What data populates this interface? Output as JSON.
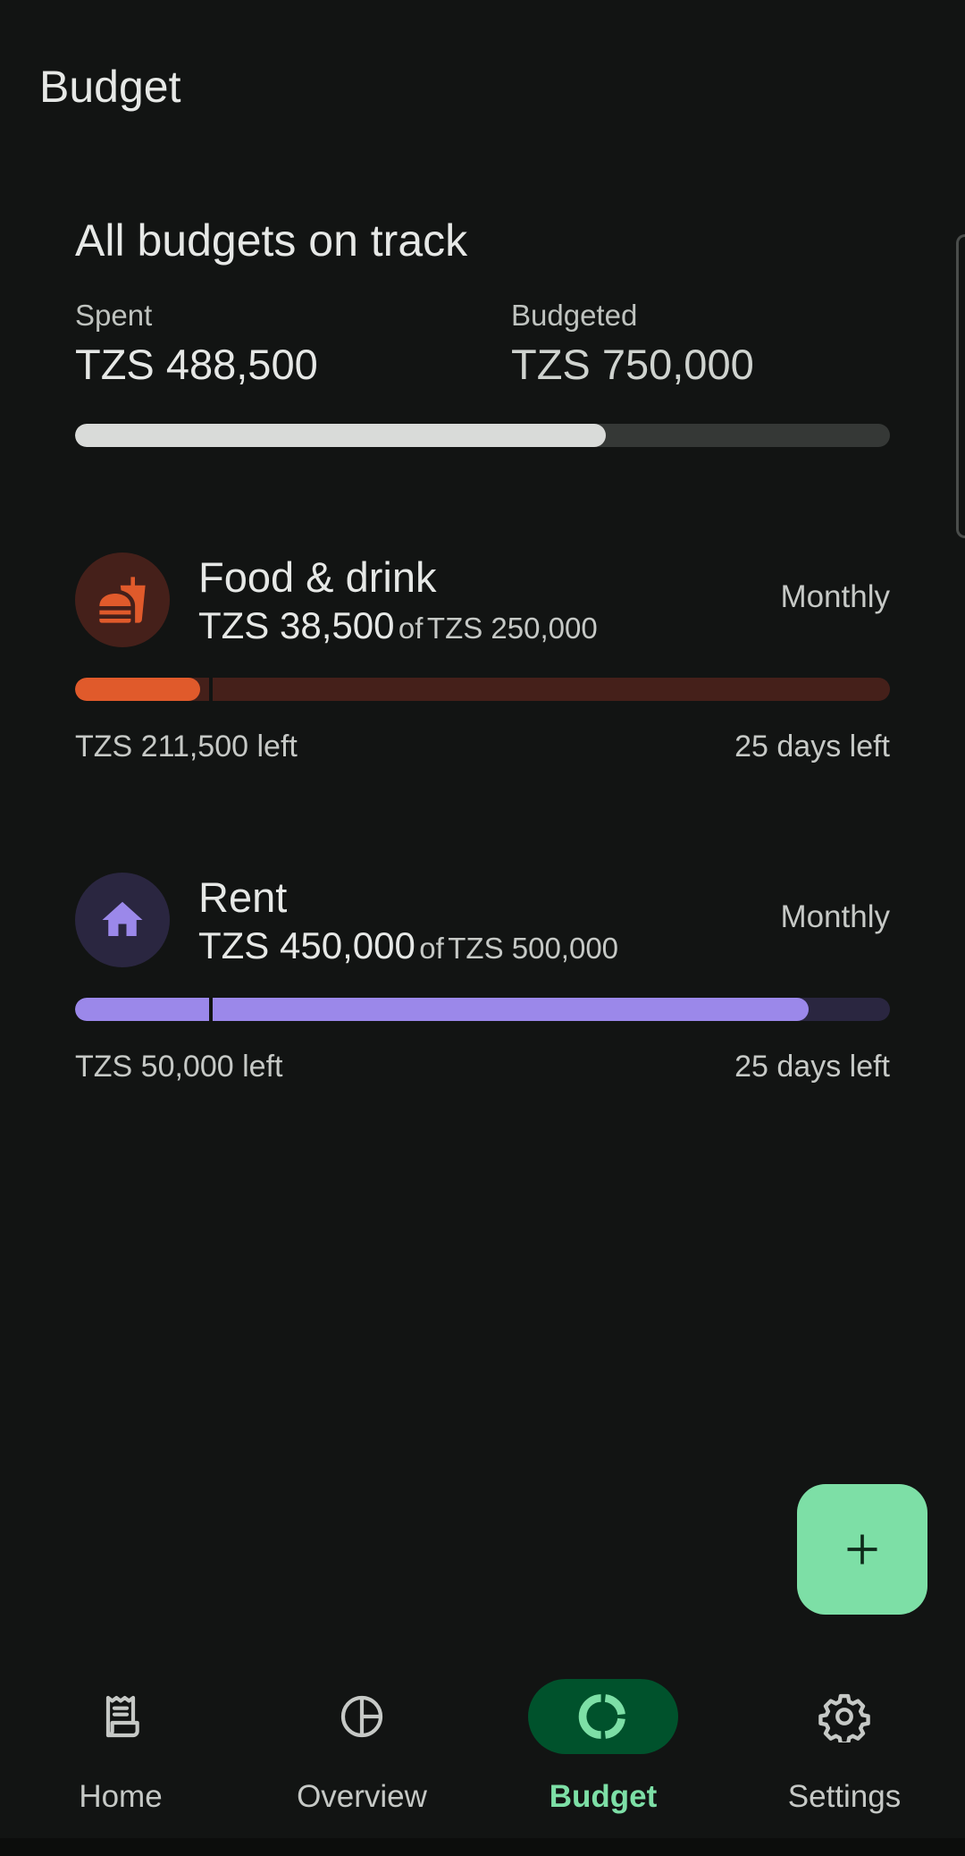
{
  "page": {
    "title": "Budget"
  },
  "summary": {
    "status": "All budgets on track",
    "spent_label": "Spent",
    "spent_value": "TZS 488,500",
    "budgeted_label": "Budgeted",
    "budgeted_value": "TZS 750,000",
    "progress_fraction": 0.651,
    "colors": {
      "fill": "#d9dbd9",
      "track": "#353836"
    }
  },
  "budgets": [
    {
      "name": "Food & drink",
      "icon": "fastfood-icon",
      "spent": "TZS 38,500",
      "of_label": "of",
      "total": "TZS 250,000",
      "period": "Monthly",
      "left": "TZS 211,500 left",
      "days_left": "25 days left",
      "progress_fraction": 0.154,
      "time_marker_fraction": 0.165,
      "colors": {
        "fill": "#e05a2b",
        "track": "#45201a",
        "icon_bg": "#45201a",
        "icon_fg": "#e05a2b"
      }
    },
    {
      "name": "Rent",
      "icon": "house-icon",
      "spent": "TZS 450,000",
      "of_label": "of",
      "total": "TZS 500,000",
      "period": "Monthly",
      "left": "TZS 50,000 left",
      "days_left": "25 days left",
      "progress_fraction": 0.9,
      "time_marker_fraction": 0.165,
      "colors": {
        "fill": "#9b88ea",
        "track": "#2a2640",
        "icon_bg": "#2a2640",
        "icon_fg": "#9b88ea"
      }
    }
  ],
  "fab": {
    "icon": "plus-icon",
    "color": "#7ddfa6"
  },
  "nav": {
    "items": [
      {
        "label": "Home",
        "icon": "receipt-icon",
        "active": false
      },
      {
        "label": "Overview",
        "icon": "pie-chart-icon",
        "active": false
      },
      {
        "label": "Budget",
        "icon": "donut-icon",
        "active": true
      },
      {
        "label": "Settings",
        "icon": "gear-icon",
        "active": false
      }
    ],
    "colors": {
      "active": "#7ddfa6",
      "active_pill": "#00522c",
      "inactive": "#c6c9c6"
    }
  }
}
